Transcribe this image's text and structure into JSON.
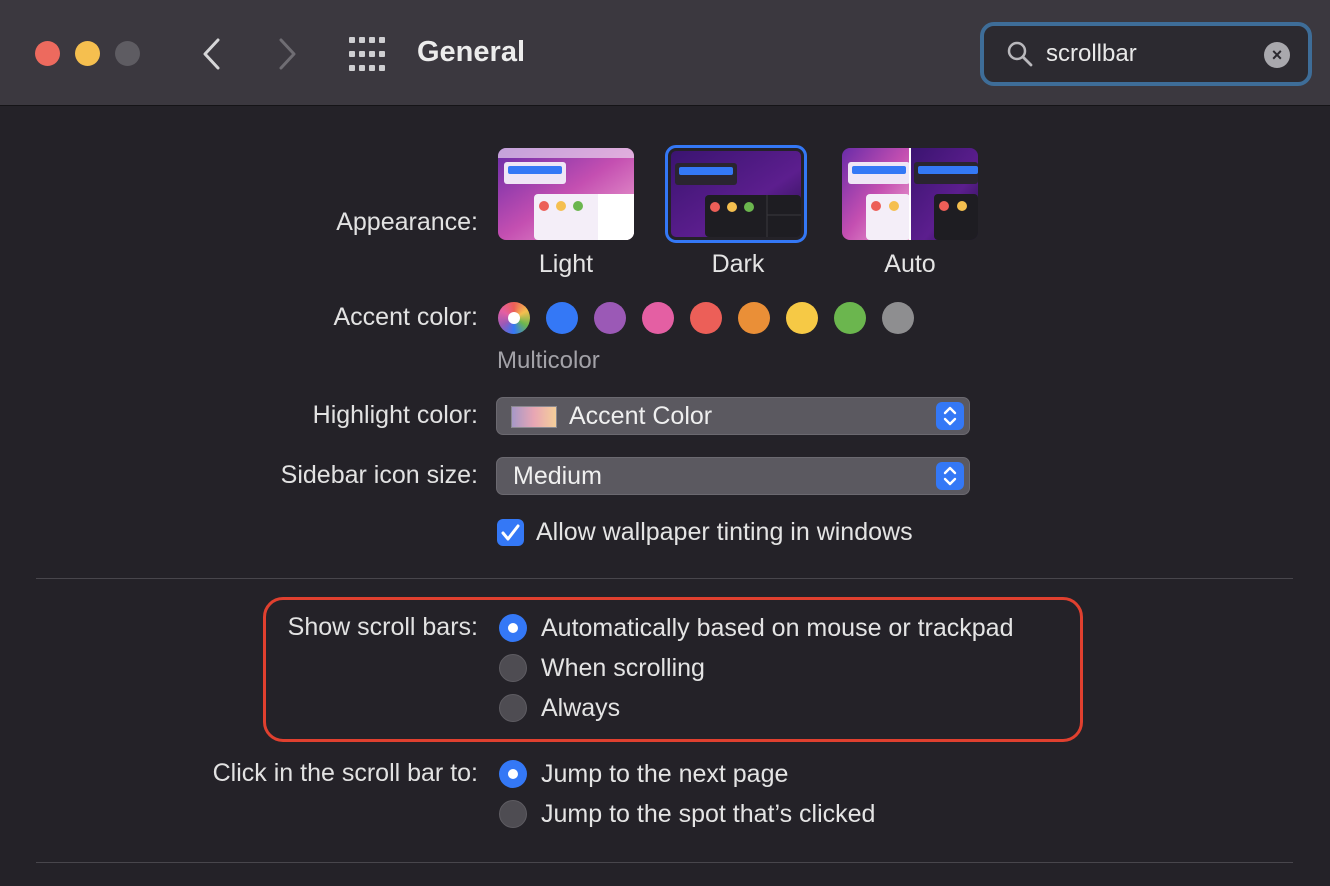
{
  "window": {
    "title": "General"
  },
  "search": {
    "value": "scrollbar",
    "clear_icon": "×"
  },
  "appearance": {
    "label": "Appearance:",
    "options": [
      {
        "name": "Light",
        "selected": false
      },
      {
        "name": "Dark",
        "selected": true
      },
      {
        "name": "Auto",
        "selected": false
      }
    ]
  },
  "accent": {
    "label": "Accent color:",
    "caption": "Multicolor",
    "colors": [
      "multicolor",
      "#3478f6",
      "#9b59b6",
      "#e45fa3",
      "#ec5f58",
      "#ea8f37",
      "#f6c945",
      "#6bb64e",
      "#8e8e90"
    ]
  },
  "highlight": {
    "label": "Highlight color:",
    "value": "Accent Color"
  },
  "sidebar_icon_size": {
    "label": "Sidebar icon size:",
    "value": "Medium"
  },
  "wallpaper_tinting": {
    "label": "Allow wallpaper tinting in windows",
    "checked": true
  },
  "scroll_bars": {
    "label": "Show scroll bars:",
    "options": [
      {
        "text": "Automatically based on mouse or trackpad",
        "selected": true
      },
      {
        "text": "When scrolling",
        "selected": false
      },
      {
        "text": "Always",
        "selected": false
      }
    ]
  },
  "click_scroll_bar": {
    "label": "Click in the scroll bar to:",
    "options": [
      {
        "text": "Jump to the next page",
        "selected": true
      },
      {
        "text": "Jump to the spot that’s clicked",
        "selected": false
      }
    ]
  },
  "colors": {
    "accent_blue": "#3478f6",
    "highlight_red": "#e0402f",
    "search_border": "#3e6d98"
  }
}
